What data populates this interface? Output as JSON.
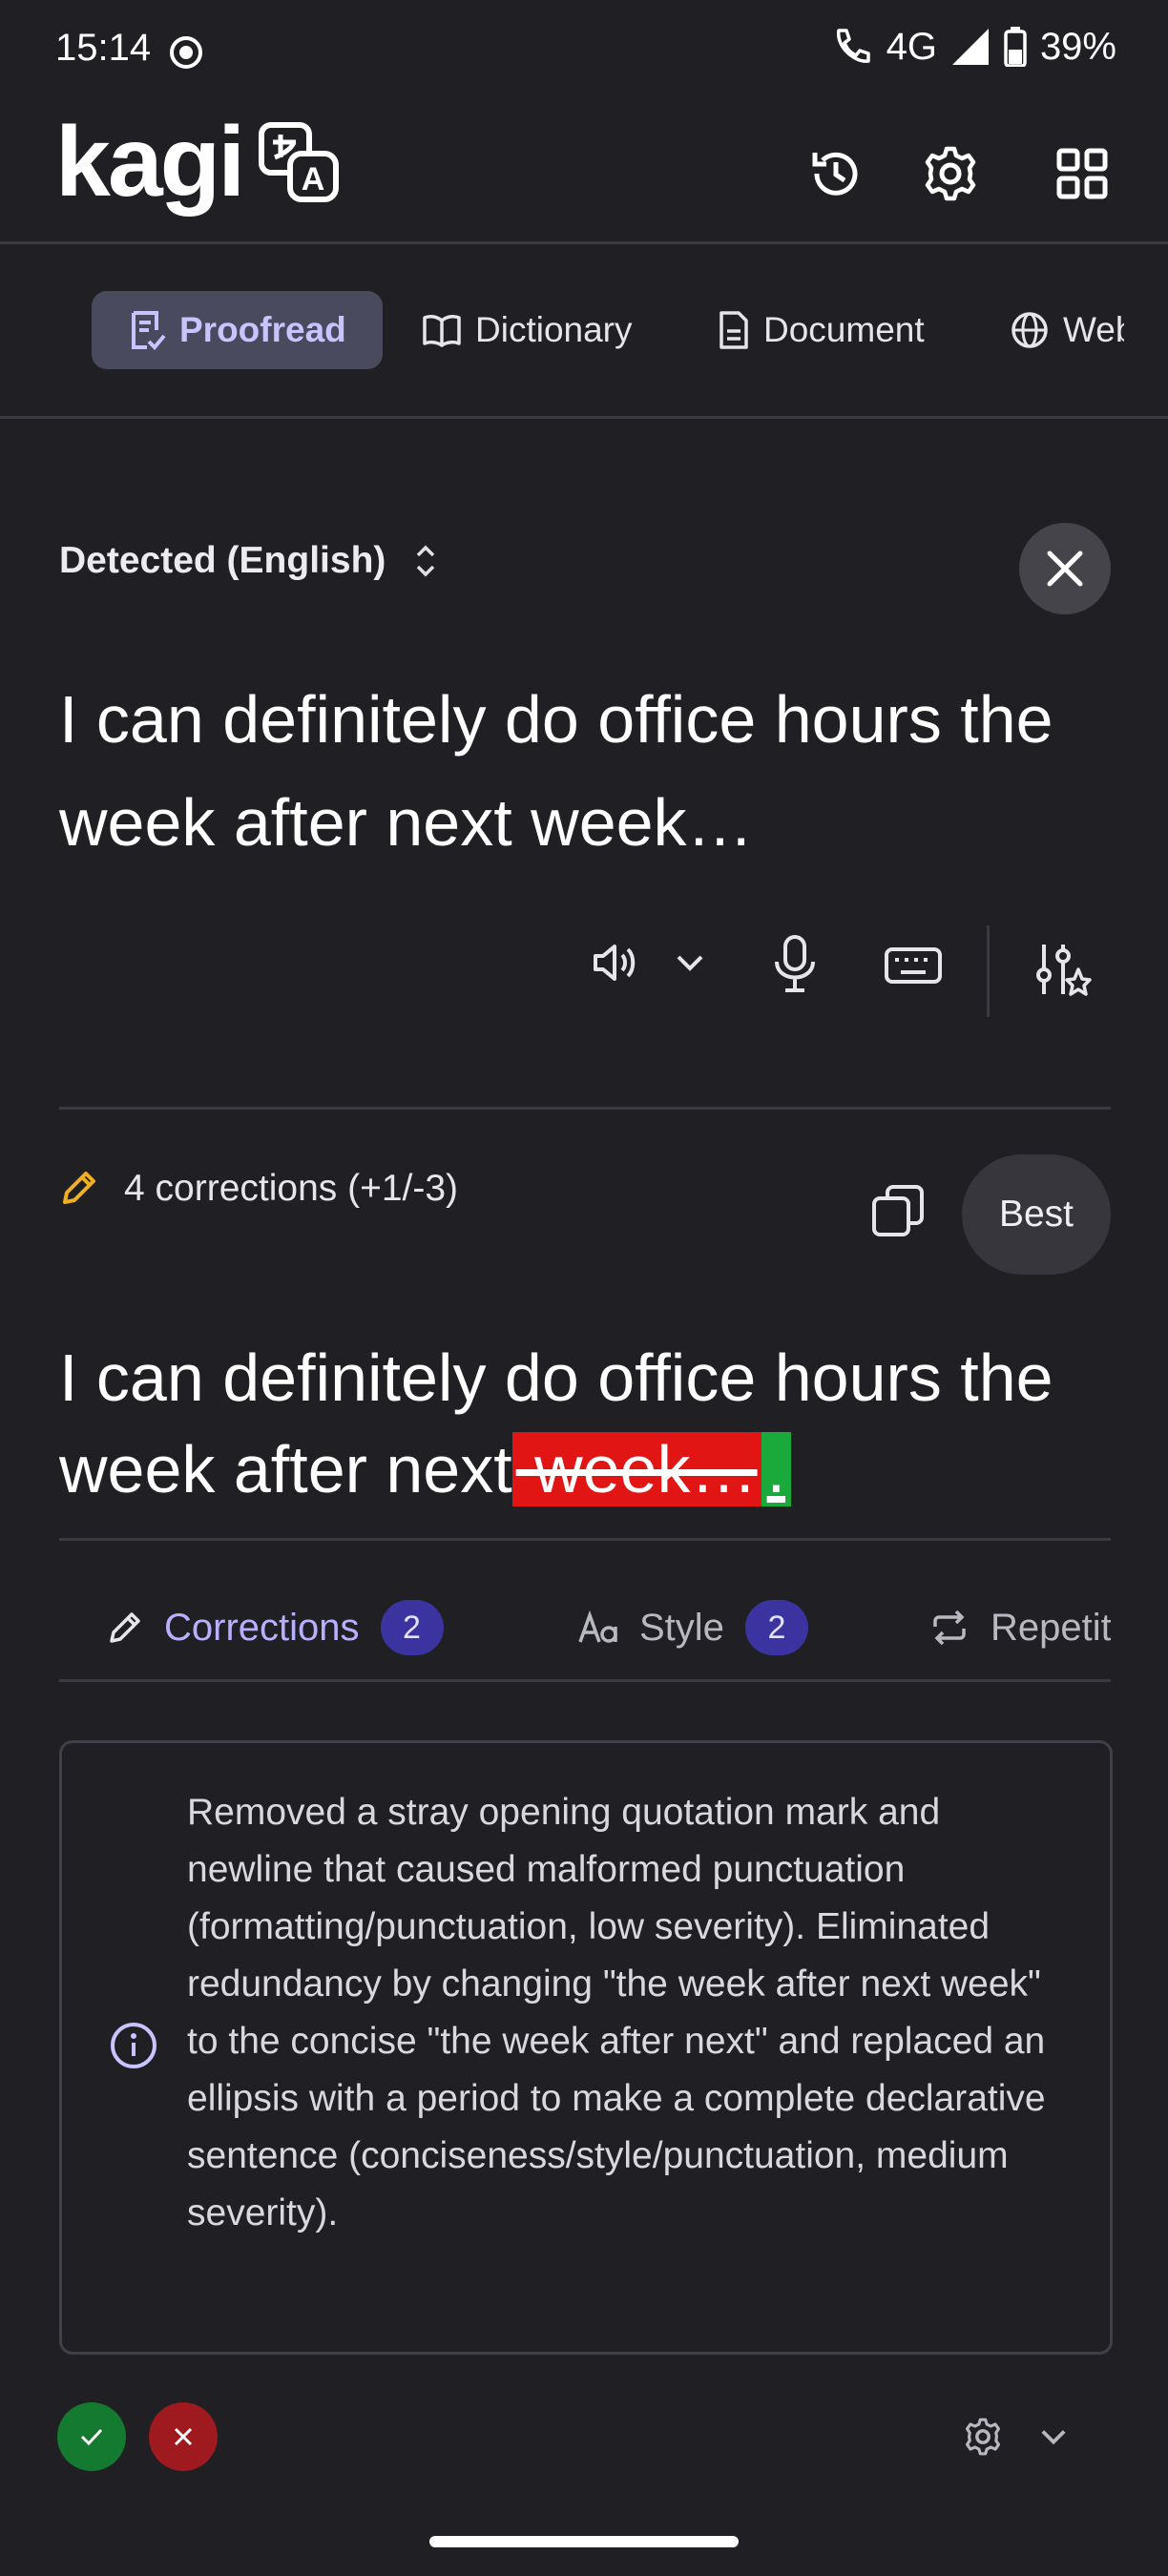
{
  "status_bar": {
    "time": "15:14",
    "network": "4G",
    "battery": "39%"
  },
  "header": {
    "logo_text": "kagi"
  },
  "tabs": [
    {
      "label": "Proofread"
    },
    {
      "label": "Dictionary"
    },
    {
      "label": "Document"
    },
    {
      "label": "Web"
    }
  ],
  "input": {
    "language_label": "Detected (English)",
    "text": "I can definitely do office hours the week after next week…"
  },
  "corrections": {
    "summary": "4 corrections (+1/-3)",
    "best_label": "Best",
    "output_prefix": " I can definitely do office hours the week after next",
    "deleted_text": " week…",
    "inserted_text": "."
  },
  "subtabs": [
    {
      "label": "Corrections",
      "count": "2"
    },
    {
      "label": "Style",
      "count": "2"
    },
    {
      "label": "Repetitions"
    }
  ],
  "explanation": "Removed a stray opening quotation mark and newline that caused malformed punctuation (formatting/punctuation, low severity). Eliminated redundancy by changing \"the week after next week\" to the concise \"the week after next\" and replaced an ellipsis with a period to make a complete declarative sentence (conciseness/style/punctuation, medium severity).",
  "colors": {
    "background": "#202024",
    "accent": "#c9c3ff",
    "deleted": "#e21515",
    "inserted": "#1aaa3c",
    "accept": "#137a30",
    "reject": "#9e1a1e"
  }
}
